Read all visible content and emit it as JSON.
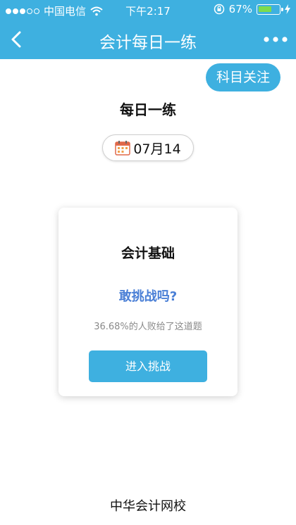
{
  "status_bar": {
    "carrier": "中国电信",
    "time": "下午2:17",
    "battery_percent": "67%",
    "battery_level": 0.67
  },
  "nav": {
    "title": "会计每日一练"
  },
  "follow_button": "科目关注",
  "section_title": "每日一练",
  "date": "07月14",
  "card": {
    "subject": "会计基础",
    "question": "敢挑战吗?",
    "stat": "36.68%的人败给了这道题",
    "button": "进入挑战"
  },
  "footer": {
    "brand": "中华会计网校"
  },
  "colors": {
    "primary": "#3eb0e0",
    "question": "#4a7fd6",
    "battery": "#7ddc4d"
  }
}
